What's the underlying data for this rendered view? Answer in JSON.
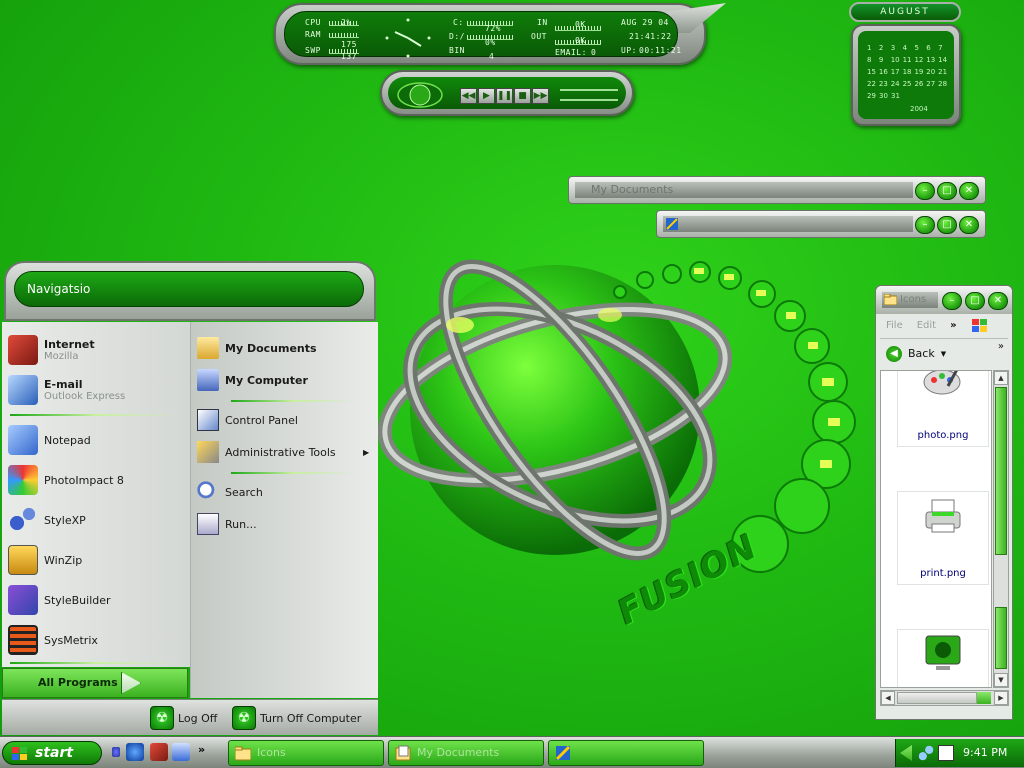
{
  "sysmon": {
    "cpu_label": "CPU",
    "cpu_value": "2%",
    "ram_label": "RAM",
    "ram_value": "175",
    "swp_label": "SWP",
    "swp_value": "137",
    "c_label": "C:",
    "c_value": "72%",
    "d_label": "D:/",
    "d_value": "0%",
    "bin_label": "BIN",
    "bin_value": "4",
    "in_label": "IN",
    "in_value": "0K",
    "out_label": "OUT",
    "out_value": "0K",
    "email_label": "EMAIL:",
    "email_value": "0",
    "date": "AUG 29 04",
    "time": "21:41:22",
    "uptime_label": "UP:",
    "uptime": "00:11:21"
  },
  "player": {
    "rewind_icon": "rewind-icon",
    "play_icon": "play-icon",
    "pause_icon": "pause-icon",
    "stop_icon": "stop-icon",
    "forward_icon": "fast-forward-icon"
  },
  "calendar": {
    "month": "AUGUST",
    "weeks": [
      [
        "1",
        "2",
        "3",
        "4",
        "5",
        "6",
        "7"
      ],
      [
        "8",
        "9",
        "10",
        "11",
        "12",
        "13",
        "14"
      ],
      [
        "15",
        "16",
        "17",
        "18",
        "19",
        "20",
        "21"
      ],
      [
        "22",
        "23",
        "24",
        "25",
        "26",
        "27",
        "28"
      ],
      [
        "29",
        "30",
        "31",
        "",
        "",
        "",
        ""
      ]
    ],
    "year": "2004"
  },
  "windows": {
    "my_documents_title": "My Documents",
    "untitled_title": ""
  },
  "start_menu": {
    "header": "Navigatsio",
    "pinned": [
      {
        "title": "Internet",
        "subtitle": "Mozilla",
        "icon": "mozilla-icon"
      },
      {
        "title": "E-mail",
        "subtitle": "Outlook Express",
        "icon": "outlook-express-icon"
      }
    ],
    "recent": [
      {
        "label": "Notepad",
        "icon": "notepad-icon"
      },
      {
        "label": "PhotoImpact 8",
        "icon": "photoimpact-icon"
      },
      {
        "label": "StyleXP",
        "icon": "stylexp-icon"
      },
      {
        "label": "WinZip",
        "icon": "winzip-icon"
      },
      {
        "label": "StyleBuilder",
        "icon": "stylebuilder-icon"
      },
      {
        "label": "SysMetrix",
        "icon": "sysmetrix-icon"
      }
    ],
    "right": [
      {
        "label": "My Documents",
        "icon": "folder-icon"
      },
      {
        "label": "My Computer",
        "icon": "computer-icon"
      },
      {
        "label": "Control Panel",
        "icon": "control-panel-icon"
      },
      {
        "label": "Administrative Tools",
        "icon": "admin-tools-icon"
      },
      {
        "label": "Search",
        "icon": "search-icon"
      },
      {
        "label": "Run...",
        "icon": "run-icon"
      }
    ],
    "all_programs": "All Programs",
    "log_off": "Log Off",
    "turn_off": "Turn Off Computer"
  },
  "explorer": {
    "title": "Icons",
    "menu": [
      "File",
      "Edit"
    ],
    "back_label": "Back",
    "files": [
      {
        "name": "",
        "icon": "paint-palette-icon"
      },
      {
        "name": "photo.png",
        "icon": "printer-icon"
      },
      {
        "name": "print.png",
        "icon": "monitor-icon"
      }
    ]
  },
  "taskbar": {
    "start_label": "start",
    "tasks": [
      {
        "label": "Icons",
        "icon": "folder-icon"
      },
      {
        "label": "My Documents",
        "icon": "documents-icon"
      },
      {
        "label": "",
        "icon": "app-icon"
      }
    ],
    "clock": "9:41 PM"
  },
  "colors": {
    "desktop": "#1fb812",
    "accent_green": "#1ea816",
    "chrome_silver": "#a9b1a9"
  },
  "desktop_text": "FUSION"
}
